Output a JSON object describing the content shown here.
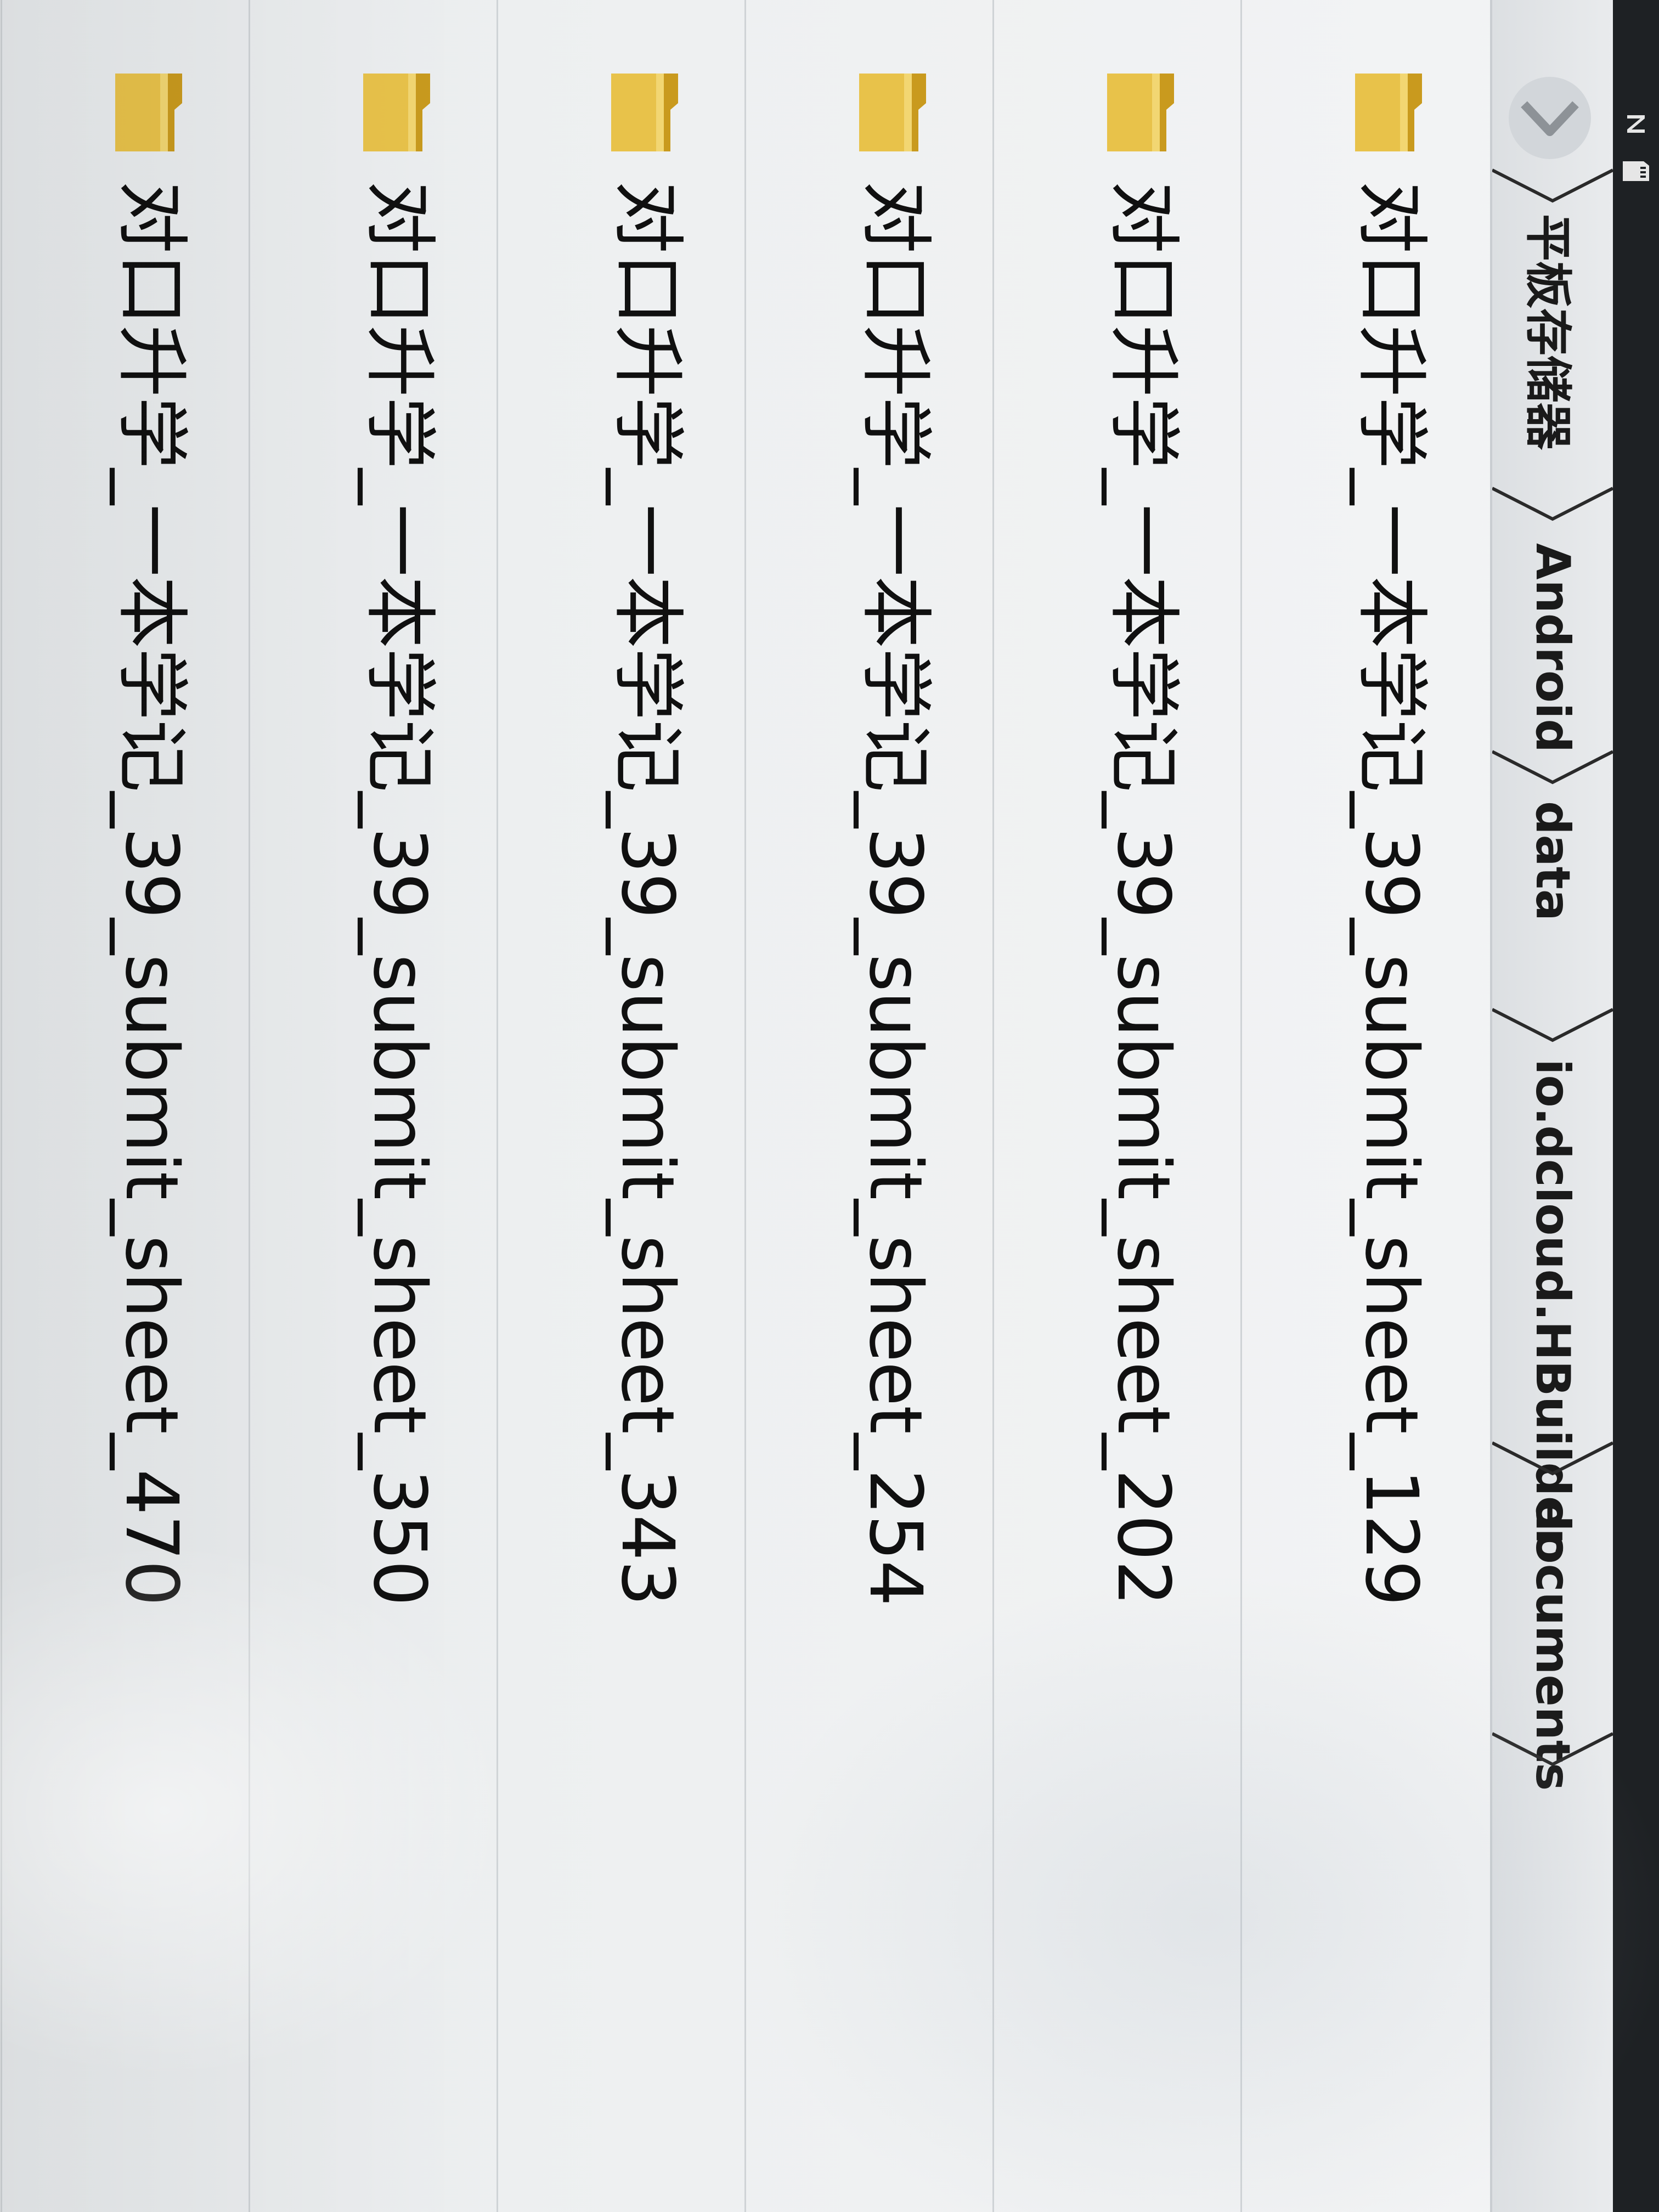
{
  "status_bar": {
    "icons": [
      "signal-n-icon",
      "sd-card-icon"
    ]
  },
  "breadcrumb": {
    "back_icon": "chevron-right-icon",
    "items": [
      {
        "label": "平板存储器"
      },
      {
        "label": "Android"
      },
      {
        "label": "data"
      },
      {
        "label": "io.dcloud.HBuilder"
      },
      {
        "label": "documents"
      }
    ]
  },
  "files": [
    {
      "name": "对口升学_一本学记_39_submit_sheet_129",
      "icon": "folder-icon"
    },
    {
      "name": "对口升学_一本学记_39_submit_sheet_202",
      "icon": "folder-icon"
    },
    {
      "name": "对口升学_一本学记_39_submit_sheet_254",
      "icon": "folder-icon"
    },
    {
      "name": "对口升学_一本学记_39_submit_sheet_343",
      "icon": "folder-icon"
    },
    {
      "name": "对口升学_一本学记_39_submit_sheet_350",
      "icon": "folder-icon"
    },
    {
      "name": "对口升学_一本学记_39_submit_sheet_470",
      "icon": "folder-icon"
    }
  ],
  "colors": {
    "folder_body": "#e8c24a",
    "folder_tab": "#c99a1e",
    "status_bar": "#1e2124",
    "text": "#101010"
  }
}
